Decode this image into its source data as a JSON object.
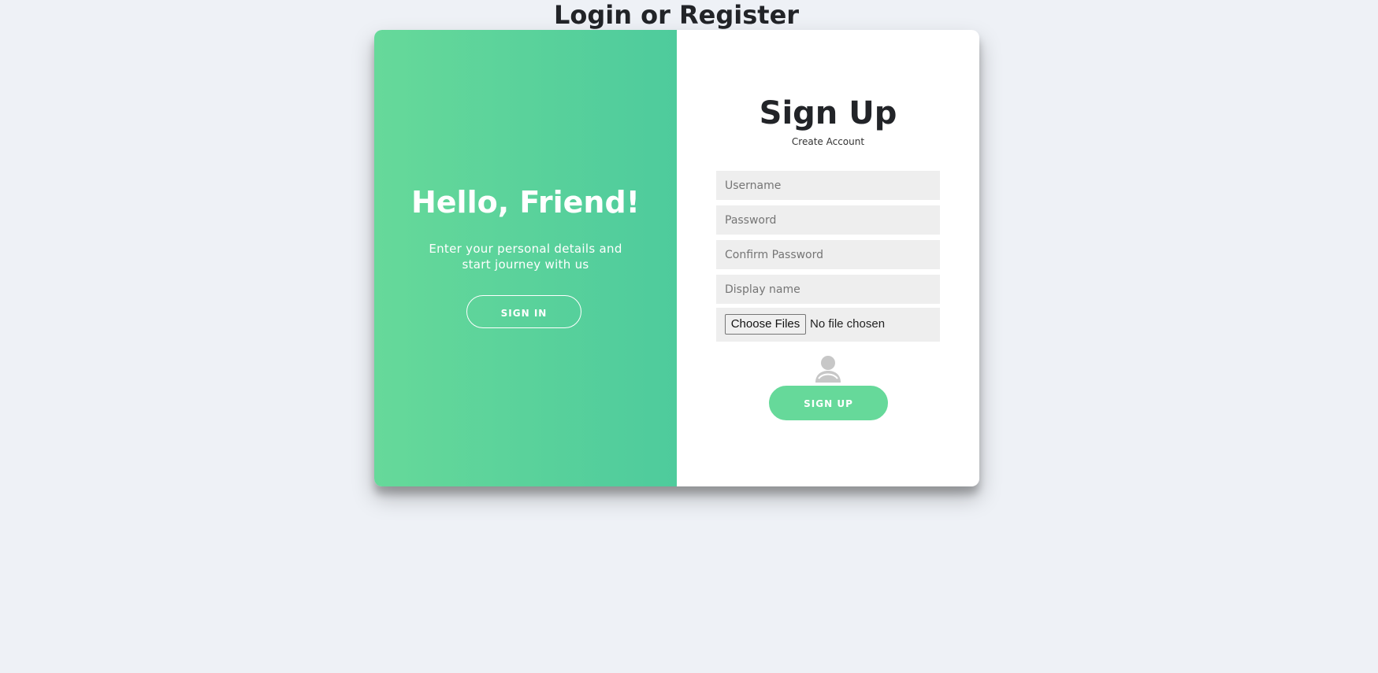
{
  "page": {
    "title": "Login or Register"
  },
  "overlay": {
    "heading": "Hello, Friend!",
    "text": "Enter your personal details and start journey with us",
    "sign_in_label": "SIGN IN",
    "gradient_start": "#66d99a",
    "gradient_end": "#4ecb9c"
  },
  "signup_form": {
    "heading": "Sign Up",
    "subtitle": "Create Account",
    "fields": [
      {
        "placeholder": "Username",
        "value": ""
      },
      {
        "placeholder": "Password",
        "value": ""
      },
      {
        "placeholder": "Confirm Password",
        "value": ""
      },
      {
        "placeholder": "Display name",
        "value": ""
      }
    ],
    "file_input": {
      "button_label": "Choose Files",
      "status": "No file chosen"
    },
    "avatar_icon": "user-avatar-placeholder-icon",
    "submit_label": "SIGN UP",
    "accent": "#66d99a",
    "field_background": "#eeeeee"
  }
}
